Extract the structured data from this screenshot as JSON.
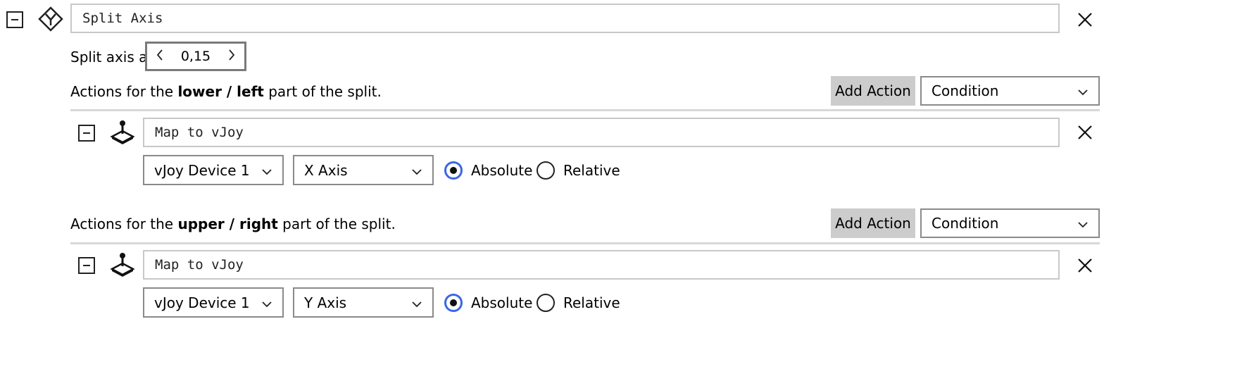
{
  "split": {
    "title": "Split Axis",
    "split_at_label": "Split axis at",
    "split_value": "0,15",
    "prev_icon": "chevron-left-icon",
    "next_icon": "chevron-right-icon"
  },
  "lower": {
    "label_prefix": "Actions for the ",
    "label_bold": "lower / left",
    "label_suffix": " part of the split.",
    "add_action": "Add Action",
    "condition": "Condition",
    "action": {
      "title": "Map to vJoy",
      "device": "vJoy Device 1",
      "axis": "X Axis",
      "absolute": "Absolute",
      "relative": "Relative",
      "mode": "absolute"
    }
  },
  "upper": {
    "label_prefix": "Actions for the ",
    "label_bold": "upper / right",
    "label_suffix": " part of the split.",
    "add_action": "Add Action",
    "condition": "Condition",
    "action": {
      "title": "Map to vJoy",
      "device": "vJoy Device 1",
      "axis": "Y Axis",
      "absolute": "Absolute",
      "relative": "Relative",
      "mode": "absolute"
    }
  },
  "colors": {
    "radio_accent": "#3b66e6",
    "button_gray": "#cccccc"
  }
}
